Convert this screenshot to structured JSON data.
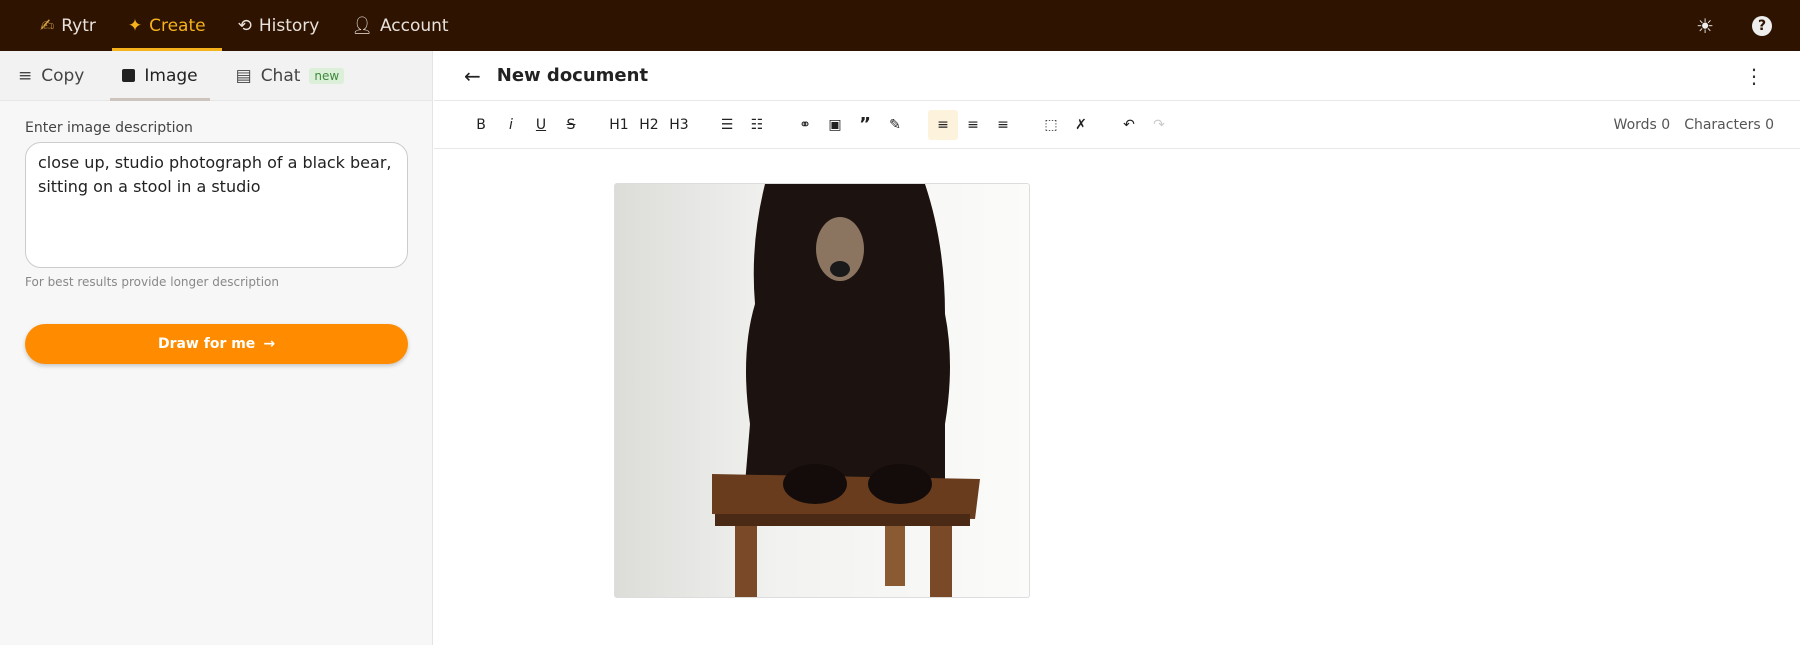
{
  "topbar": {
    "brand": "Rytr",
    "items": [
      {
        "label": "Create",
        "active": true
      },
      {
        "label": "History"
      },
      {
        "label": "Account"
      }
    ]
  },
  "sidebar": {
    "tabs": [
      {
        "label": "Copy"
      },
      {
        "label": "Image",
        "active": true
      },
      {
        "label": "Chat",
        "badge": "new"
      }
    ],
    "description_label": "Enter image description",
    "description_value": "close up, studio photograph of a black bear, sitting on a stool in a studio",
    "hint": "For best results provide longer description",
    "draw_button": "Draw for me"
  },
  "document": {
    "title": "New document",
    "words_label": "Words",
    "words": "0",
    "chars_label": "Characters",
    "chars": "0",
    "toolbar": [
      "B",
      "i",
      "U",
      "S",
      "H1",
      "H2",
      "H3"
    ]
  },
  "colors": {
    "topbar": "#2d1300",
    "accent": "#f6b21b",
    "button": "#ff8c00"
  }
}
